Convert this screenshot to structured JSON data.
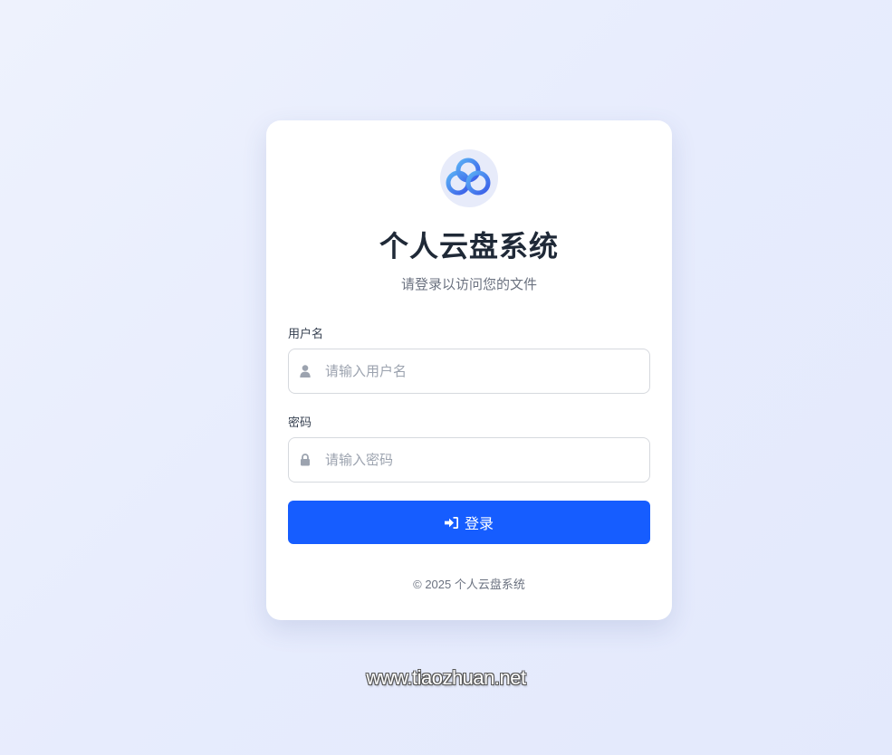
{
  "app": {
    "title": "个人云盘系统",
    "subtitle": "请登录以访问您的文件",
    "logo_icon": "cloud-icon"
  },
  "form": {
    "username": {
      "label": "用户名",
      "placeholder": "请输入用户名",
      "value": "",
      "icon": "user-icon"
    },
    "password": {
      "label": "密码",
      "placeholder": "请输入密码",
      "value": "",
      "icon": "lock-icon"
    },
    "submit": {
      "label": "登录",
      "icon": "sign-in-icon"
    }
  },
  "footer": {
    "text": "© 2025 个人云盘系统"
  },
  "watermark": {
    "text": "www.tiaozhuan.net"
  },
  "colors": {
    "accent": "#165dff",
    "background": "#e9eefc",
    "card": "#ffffff",
    "title": "#1f2937",
    "muted": "#6b7280"
  }
}
